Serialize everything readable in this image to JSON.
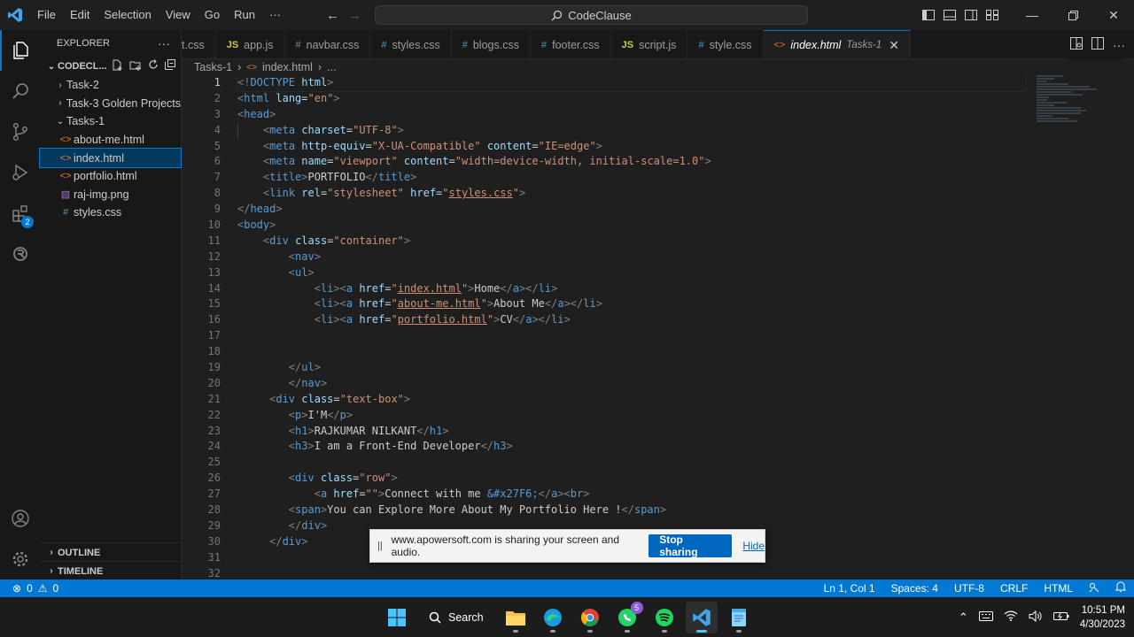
{
  "titlebar": {
    "menu": [
      "File",
      "Edit",
      "Selection",
      "View",
      "Go",
      "Run",
      "···"
    ],
    "search_text": "CodeClause"
  },
  "activity": {
    "extensions_badge": "2"
  },
  "sidebar": {
    "title": "EXPLORER",
    "root_label": "CODECL...",
    "items": [
      {
        "label": "Task-2",
        "type": "folder",
        "open": false,
        "depth": 0,
        "icon": "›"
      },
      {
        "label": "Task-3 Golden Projects",
        "type": "folder",
        "open": false,
        "depth": 0,
        "icon": "›"
      },
      {
        "label": "Tasks-1",
        "type": "folder",
        "open": true,
        "depth": 0,
        "icon": "⌄"
      },
      {
        "label": "about-me.html",
        "type": "html",
        "depth": 1,
        "icon": "<>"
      },
      {
        "label": "index.html",
        "type": "html",
        "depth": 1,
        "icon": "<>",
        "selected": true
      },
      {
        "label": "portfolio.html",
        "type": "html",
        "depth": 1,
        "icon": "<>"
      },
      {
        "label": "raj-img.png",
        "type": "png",
        "depth": 1,
        "icon": "▨"
      },
      {
        "label": "styles.css",
        "type": "css",
        "depth": 1,
        "icon": "#"
      }
    ],
    "outline_label": "OUTLINE",
    "timeline_label": "TIMELINE"
  },
  "tabs": [
    {
      "label": "t.css",
      "kind": "css"
    },
    {
      "label": "app.js",
      "kind": "js"
    },
    {
      "label": "navbar.css",
      "kind": "css"
    },
    {
      "label": "styles.css",
      "kind": "css"
    },
    {
      "label": "blogs.css",
      "kind": "css"
    },
    {
      "label": "footer.css",
      "kind": "css"
    },
    {
      "label": "script.js",
      "kind": "js"
    },
    {
      "label": "style.css",
      "kind": "css"
    },
    {
      "label": "index.html",
      "kind": "html",
      "active": true,
      "desc": "Tasks-1"
    }
  ],
  "breadcrumb": {
    "folder": "Tasks-1",
    "file": "index.html",
    "tail": "..."
  },
  "editor": {
    "current_line": 1,
    "lines": [
      [
        [
          "p",
          "<!"
        ],
        [
          "t",
          "DOCTYPE"
        ],
        [
          "x",
          " "
        ],
        [
          "a",
          "html"
        ],
        [
          "p",
          ">"
        ]
      ],
      [
        [
          "p",
          "<"
        ],
        [
          "t",
          "html"
        ],
        [
          "x",
          " "
        ],
        [
          "a",
          "lang"
        ],
        [
          "x",
          "="
        ],
        [
          "s",
          "\"en\""
        ],
        [
          "p",
          ">"
        ]
      ],
      [
        [
          "p",
          "<"
        ],
        [
          "t",
          "head"
        ],
        [
          "p",
          ">"
        ]
      ],
      [
        [
          "x",
          "    "
        ],
        [
          "p",
          "<"
        ],
        [
          "t",
          "meta"
        ],
        [
          "x",
          " "
        ],
        [
          "a",
          "charset"
        ],
        [
          "x",
          "="
        ],
        [
          "s",
          "\"UTF-8\""
        ],
        [
          "p",
          ">"
        ]
      ],
      [
        [
          "x",
          "    "
        ],
        [
          "p",
          "<"
        ],
        [
          "t",
          "meta"
        ],
        [
          "x",
          " "
        ],
        [
          "a",
          "http-equiv"
        ],
        [
          "x",
          "="
        ],
        [
          "s",
          "\"X-UA-Compatible\""
        ],
        [
          "x",
          " "
        ],
        [
          "a",
          "content"
        ],
        [
          "x",
          "="
        ],
        [
          "s",
          "\"IE=edge\""
        ],
        [
          "p",
          ">"
        ]
      ],
      [
        [
          "x",
          "    "
        ],
        [
          "p",
          "<"
        ],
        [
          "t",
          "meta"
        ],
        [
          "x",
          " "
        ],
        [
          "a",
          "name"
        ],
        [
          "x",
          "="
        ],
        [
          "s",
          "\"viewport\""
        ],
        [
          "x",
          " "
        ],
        [
          "a",
          "content"
        ],
        [
          "x",
          "="
        ],
        [
          "s",
          "\"width=device-width, initial-scale=1.0\""
        ],
        [
          "p",
          ">"
        ]
      ],
      [
        [
          "x",
          "    "
        ],
        [
          "p",
          "<"
        ],
        [
          "t",
          "title"
        ],
        [
          "p",
          ">"
        ],
        [
          "x",
          "PORTFOLIO"
        ],
        [
          "p",
          "</"
        ],
        [
          "t",
          "title"
        ],
        [
          "p",
          ">"
        ]
      ],
      [
        [
          "x",
          "    "
        ],
        [
          "p",
          "<"
        ],
        [
          "t",
          "link"
        ],
        [
          "x",
          " "
        ],
        [
          "a",
          "rel"
        ],
        [
          "x",
          "="
        ],
        [
          "s",
          "\"stylesheet\""
        ],
        [
          "x",
          " "
        ],
        [
          "a",
          "href"
        ],
        [
          "x",
          "="
        ],
        [
          "s",
          "\""
        ],
        [
          "u",
          "styles.css"
        ],
        [
          "s",
          "\""
        ],
        [
          "p",
          ">"
        ]
      ],
      [
        [
          "p",
          "</"
        ],
        [
          "t",
          "head"
        ],
        [
          "p",
          ">"
        ]
      ],
      [
        [
          "p",
          "<"
        ],
        [
          "t",
          "body"
        ],
        [
          "p",
          ">"
        ]
      ],
      [
        [
          "x",
          "    "
        ],
        [
          "p",
          "<"
        ],
        [
          "t",
          "div"
        ],
        [
          "x",
          " "
        ],
        [
          "a",
          "class"
        ],
        [
          "x",
          "="
        ],
        [
          "s",
          "\"container\""
        ],
        [
          "p",
          ">"
        ]
      ],
      [
        [
          "x",
          "        "
        ],
        [
          "p",
          "<"
        ],
        [
          "t",
          "nav"
        ],
        [
          "p",
          ">"
        ]
      ],
      [
        [
          "x",
          "        "
        ],
        [
          "p",
          "<"
        ],
        [
          "t",
          "ul"
        ],
        [
          "p",
          ">"
        ]
      ],
      [
        [
          "x",
          "            "
        ],
        [
          "p",
          "<"
        ],
        [
          "t",
          "li"
        ],
        [
          "p",
          "><"
        ],
        [
          "t",
          "a"
        ],
        [
          "x",
          " "
        ],
        [
          "a",
          "href"
        ],
        [
          "x",
          "="
        ],
        [
          "s",
          "\""
        ],
        [
          "u",
          "index.html"
        ],
        [
          "s",
          "\""
        ],
        [
          "p",
          ">"
        ],
        [
          "x",
          "Home"
        ],
        [
          "p",
          "</"
        ],
        [
          "t",
          "a"
        ],
        [
          "p",
          "></"
        ],
        [
          "t",
          "li"
        ],
        [
          "p",
          ">"
        ]
      ],
      [
        [
          "x",
          "            "
        ],
        [
          "p",
          "<"
        ],
        [
          "t",
          "li"
        ],
        [
          "p",
          "><"
        ],
        [
          "t",
          "a"
        ],
        [
          "x",
          " "
        ],
        [
          "a",
          "href"
        ],
        [
          "x",
          "="
        ],
        [
          "s",
          "\""
        ],
        [
          "u",
          "about-me.html"
        ],
        [
          "s",
          "\""
        ],
        [
          "p",
          ">"
        ],
        [
          "x",
          "About Me"
        ],
        [
          "p",
          "</"
        ],
        [
          "t",
          "a"
        ],
        [
          "p",
          "></"
        ],
        [
          "t",
          "li"
        ],
        [
          "p",
          ">"
        ]
      ],
      [
        [
          "x",
          "            "
        ],
        [
          "p",
          "<"
        ],
        [
          "t",
          "li"
        ],
        [
          "p",
          "><"
        ],
        [
          "t",
          "a"
        ],
        [
          "x",
          " "
        ],
        [
          "a",
          "href"
        ],
        [
          "x",
          "="
        ],
        [
          "s",
          "\""
        ],
        [
          "u",
          "portfolio.html"
        ],
        [
          "s",
          "\""
        ],
        [
          "p",
          ">"
        ],
        [
          "x",
          "CV"
        ],
        [
          "p",
          "</"
        ],
        [
          "t",
          "a"
        ],
        [
          "p",
          "></"
        ],
        [
          "t",
          "li"
        ],
        [
          "p",
          ">"
        ]
      ],
      [],
      [],
      [
        [
          "x",
          "        "
        ],
        [
          "p",
          "</"
        ],
        [
          "t",
          "ul"
        ],
        [
          "p",
          ">"
        ]
      ],
      [
        [
          "x",
          "        "
        ],
        [
          "p",
          "</"
        ],
        [
          "t",
          "nav"
        ],
        [
          "p",
          ">"
        ]
      ],
      [
        [
          "x",
          "     "
        ],
        [
          "p",
          "<"
        ],
        [
          "t",
          "div"
        ],
        [
          "x",
          " "
        ],
        [
          "a",
          "class"
        ],
        [
          "x",
          "="
        ],
        [
          "s",
          "\"text-box\""
        ],
        [
          "p",
          ">"
        ]
      ],
      [
        [
          "x",
          "        "
        ],
        [
          "p",
          "<"
        ],
        [
          "t",
          "p"
        ],
        [
          "p",
          ">"
        ],
        [
          "x",
          "I'M"
        ],
        [
          "p",
          "</"
        ],
        [
          "t",
          "p"
        ],
        [
          "p",
          ">"
        ]
      ],
      [
        [
          "x",
          "        "
        ],
        [
          "p",
          "<"
        ],
        [
          "t",
          "h1"
        ],
        [
          "p",
          ">"
        ],
        [
          "x",
          "RAJKUMAR NILKANT"
        ],
        [
          "p",
          "</"
        ],
        [
          "t",
          "h1"
        ],
        [
          "p",
          ">"
        ]
      ],
      [
        [
          "x",
          "        "
        ],
        [
          "p",
          "<"
        ],
        [
          "t",
          "h3"
        ],
        [
          "p",
          ">"
        ],
        [
          "x",
          "I am a Front-End Developer"
        ],
        [
          "p",
          "</"
        ],
        [
          "t",
          "h3"
        ],
        [
          "p",
          ">"
        ]
      ],
      [],
      [
        [
          "x",
          "        "
        ],
        [
          "p",
          "<"
        ],
        [
          "t",
          "div"
        ],
        [
          "x",
          " "
        ],
        [
          "a",
          "class"
        ],
        [
          "x",
          "="
        ],
        [
          "s",
          "\"row\""
        ],
        [
          "p",
          ">"
        ]
      ],
      [
        [
          "x",
          "            "
        ],
        [
          "p",
          "<"
        ],
        [
          "t",
          "a"
        ],
        [
          "x",
          " "
        ],
        [
          "a",
          "href"
        ],
        [
          "x",
          "="
        ],
        [
          "s",
          "\"\""
        ],
        [
          "p",
          ">"
        ],
        [
          "x",
          "Connect with me "
        ],
        [
          "e",
          "&#x27F6;"
        ],
        [
          "p",
          "</"
        ],
        [
          "t",
          "a"
        ],
        [
          "p",
          "><"
        ],
        [
          "t",
          "br"
        ],
        [
          "p",
          ">"
        ]
      ],
      [
        [
          "x",
          "        "
        ],
        [
          "p",
          "<"
        ],
        [
          "t",
          "span"
        ],
        [
          "p",
          ">"
        ],
        [
          "x",
          "You can Explore More About My Portfolio Here !"
        ],
        [
          "p",
          "</"
        ],
        [
          "t",
          "span"
        ],
        [
          "p",
          ">"
        ]
      ],
      [
        [
          "x",
          "        "
        ],
        [
          "p",
          "</"
        ],
        [
          "t",
          "div"
        ],
        [
          "p",
          ">"
        ]
      ],
      [
        [
          "x",
          "     "
        ],
        [
          "p",
          "</"
        ],
        [
          "t",
          "div"
        ],
        [
          "p",
          ">"
        ]
      ],
      [],
      []
    ]
  },
  "share_banner": {
    "text": "www.apowersoft.com is sharing your screen and audio.",
    "stop_label": "Stop sharing",
    "hide_label": "Hide"
  },
  "statusbar": {
    "errors": "0",
    "warnings": "0",
    "position": "Ln 1, Col 1",
    "spaces": "Spaces: 4",
    "encoding": "UTF-8",
    "eol": "CRLF",
    "language": "HTML"
  },
  "taskbar": {
    "search_label": "Search",
    "whatsapp_badge": "5",
    "time": "10:51 PM",
    "date": "4/30/2023"
  },
  "colors": {
    "accent": "#0078d4",
    "statusbar": "#0078d4",
    "editor_bg": "#1f1f1f"
  }
}
